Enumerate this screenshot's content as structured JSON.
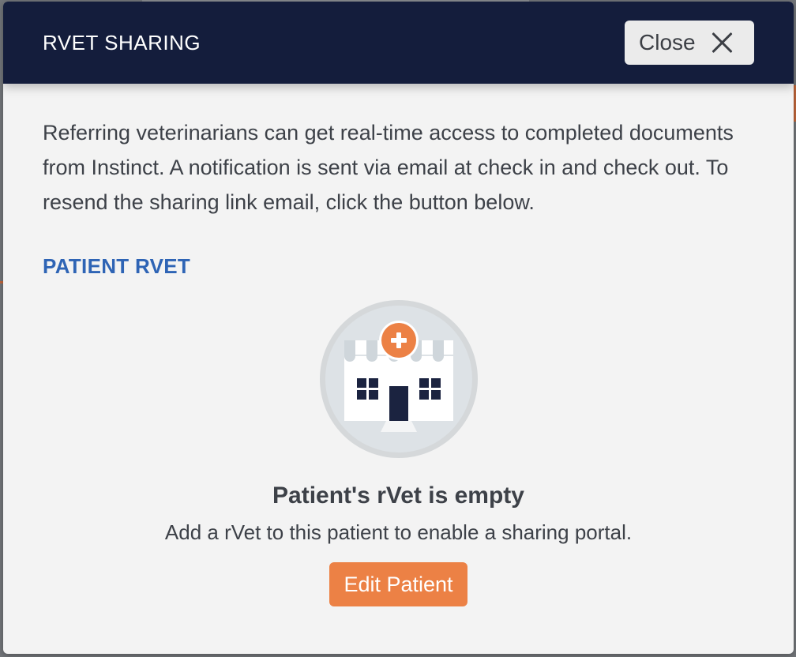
{
  "modal": {
    "title": "RVET SHARING",
    "close_label": "Close",
    "description": "Referring veterinarians can get real-time access to completed documents from Instinct. A notification is sent via email at check in and check out. To resend the sharing link email, click the button below.",
    "section_title": "PATIENT RVET",
    "empty_state": {
      "illustration_icon": "clinic-building-icon",
      "title": "Patient's rVet is empty",
      "description": "Add a rVet to this patient to enable a sharing portal.",
      "button_label": "Edit Patient"
    }
  },
  "colors": {
    "header_bg": "#141d3c",
    "accent_orange": "#ec8145",
    "link_blue": "#2e64b5",
    "modal_bg": "#f3f3f3"
  }
}
